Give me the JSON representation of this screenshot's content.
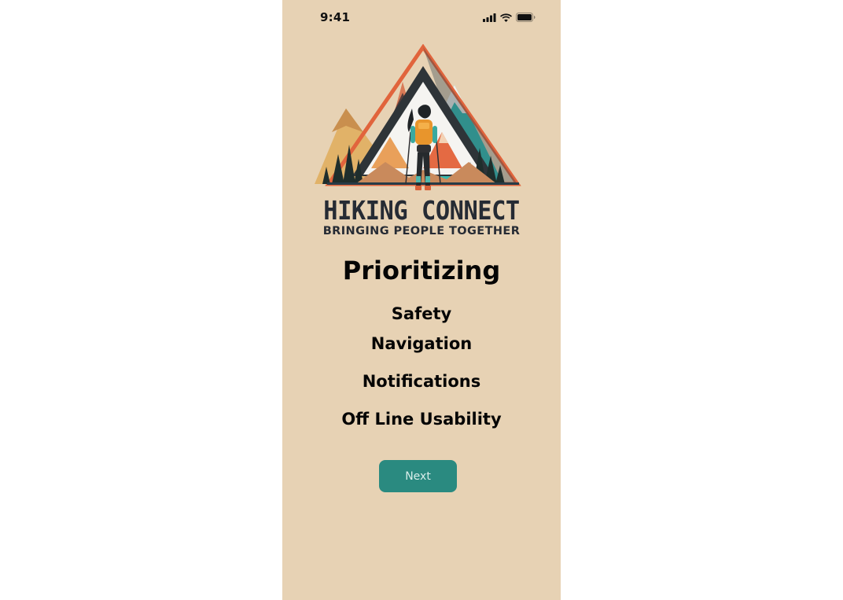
{
  "status_bar": {
    "time": "9:41",
    "icons": [
      "cellular-signal-icon",
      "wifi-icon",
      "battery-icon"
    ]
  },
  "brand": {
    "name": "HIKING CONNECT",
    "tagline": "BRINGING PEOPLE TOGETHER"
  },
  "main": {
    "heading": "Prioritizing",
    "features": [
      "Safety",
      "Navigation",
      "Notifications",
      "Off Line Usability"
    ]
  },
  "actions": {
    "next_label": "Next"
  },
  "colors": {
    "background": "#e7d2b4",
    "accent": "#2a8a80",
    "text": "#050505",
    "brand_text": "#262b34"
  }
}
